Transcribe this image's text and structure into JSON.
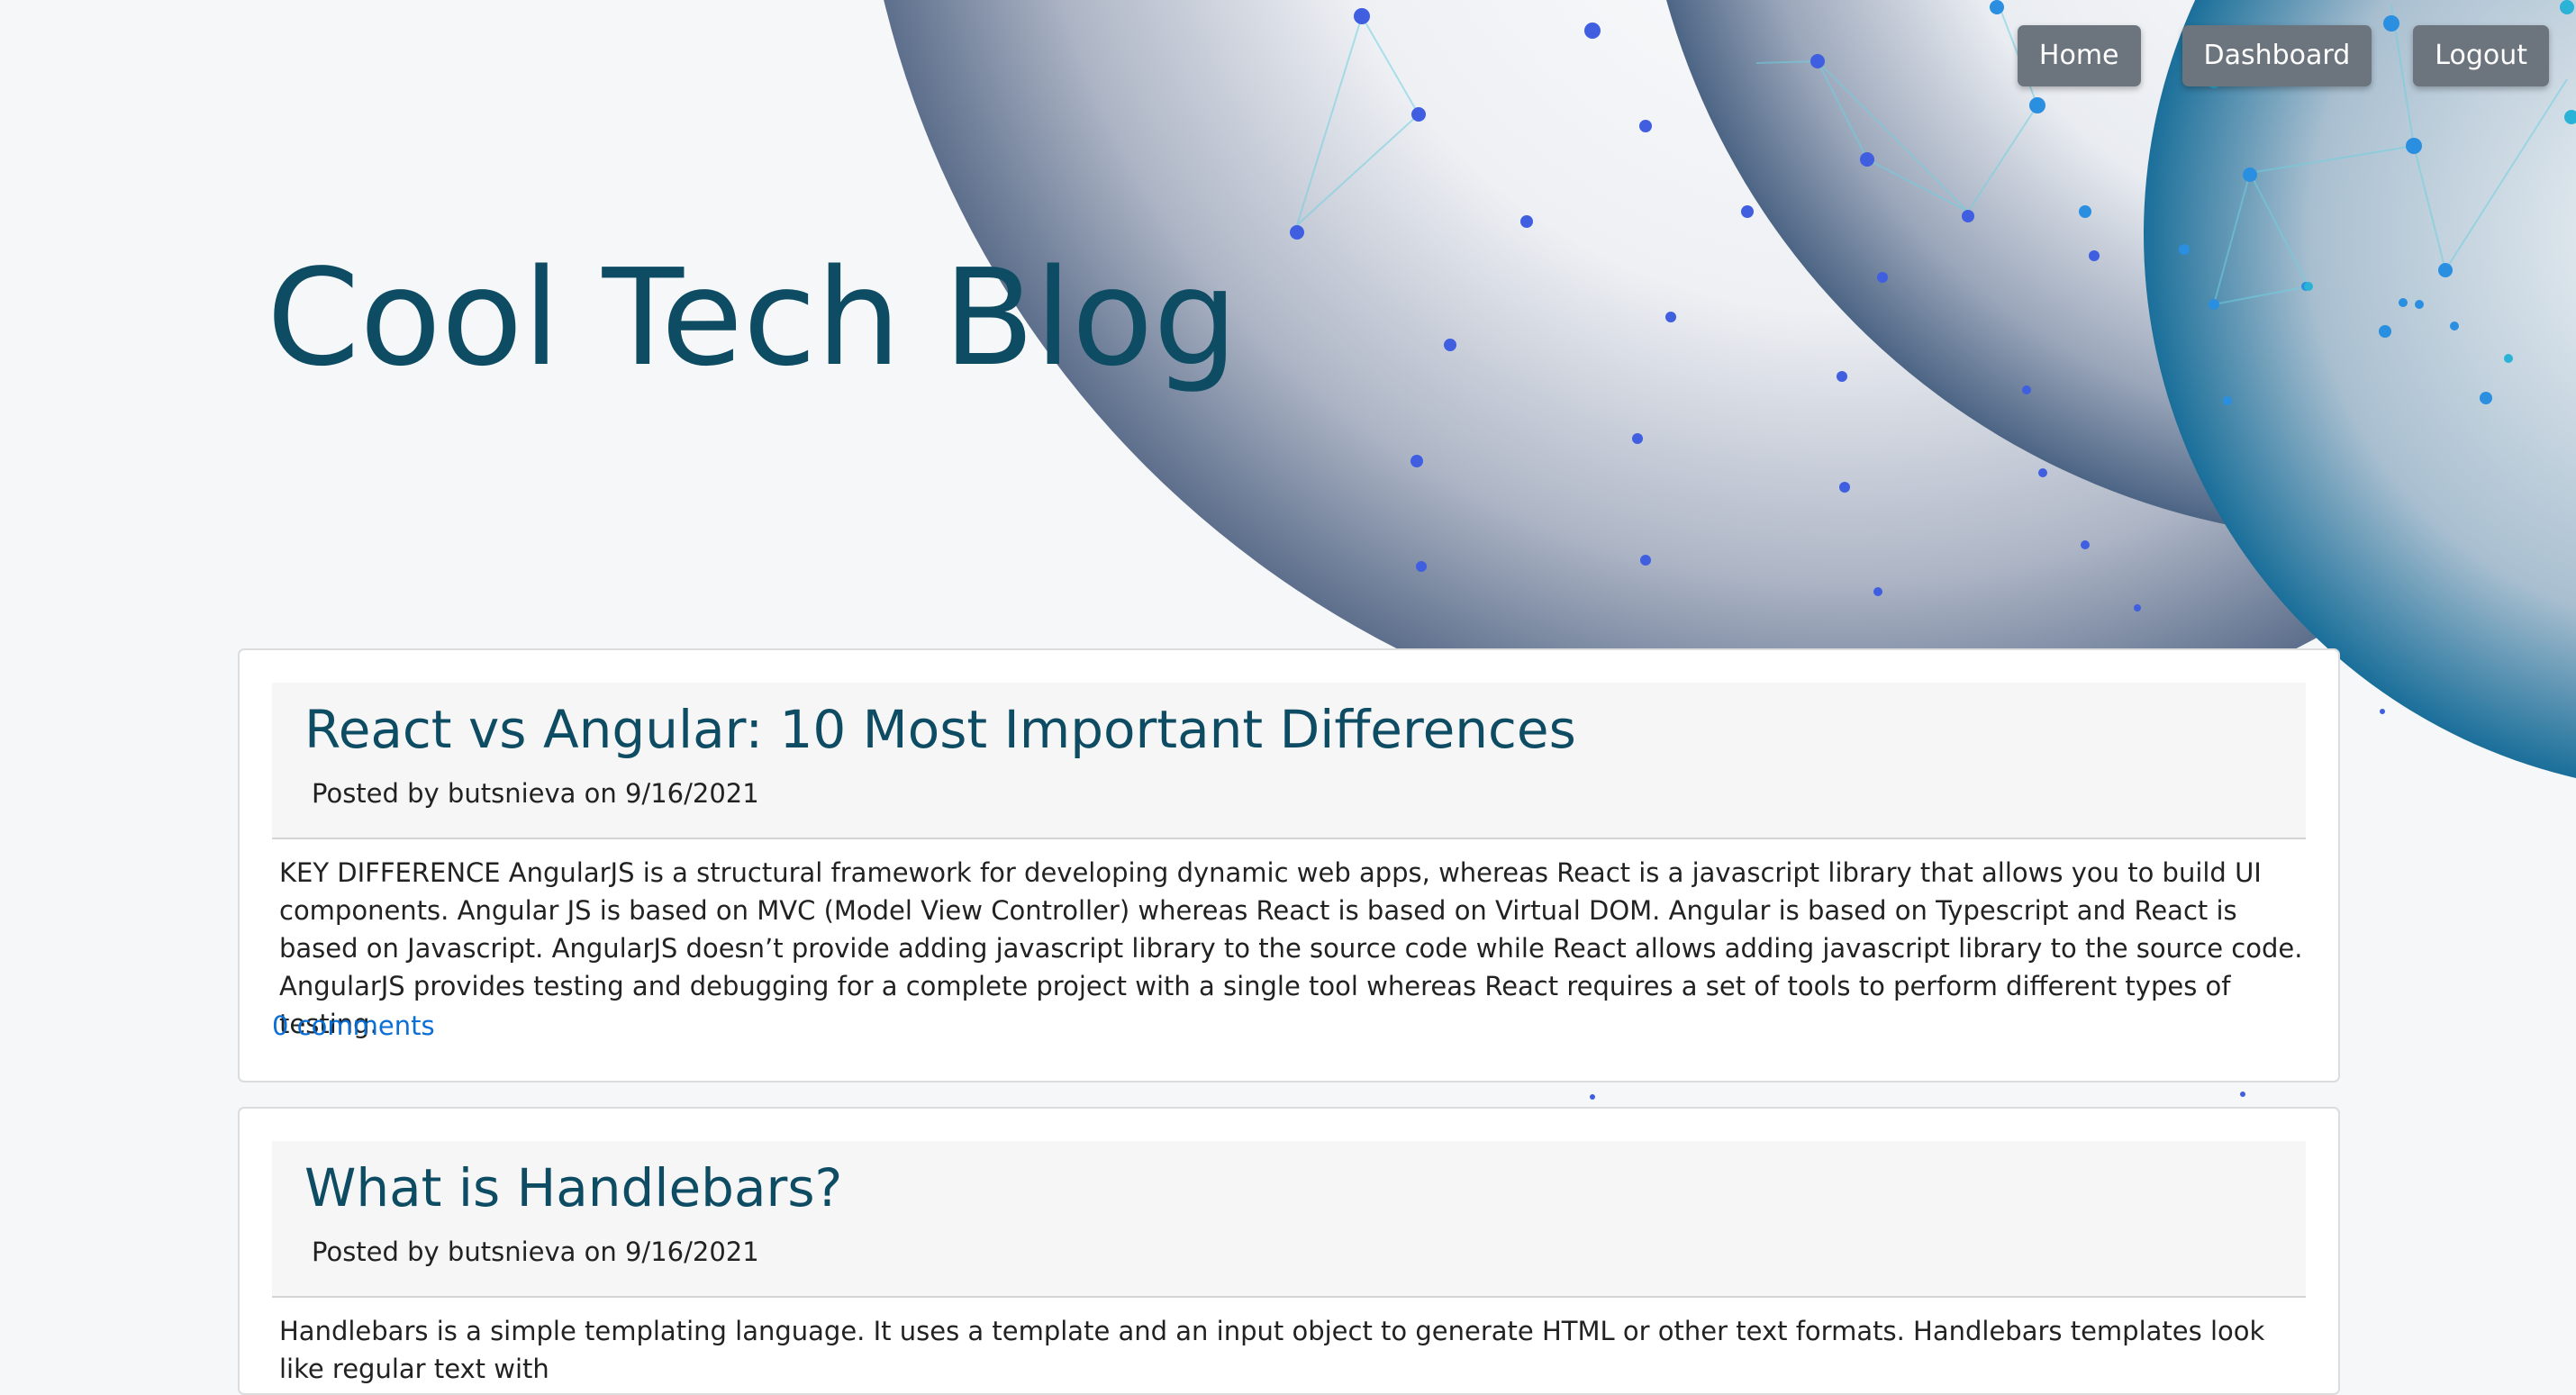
{
  "nav": {
    "home": "Home",
    "dashboard": "Dashboard",
    "logout": "Logout"
  },
  "header": {
    "title": "Cool Tech Blog"
  },
  "posts": [
    {
      "title": "React vs Angular: 10 Most Important Differences",
      "meta": "Posted by butsnieva on 9/16/2021",
      "body": "KEY DIFFERENCE AngularJS is a structural framework for developing dynamic web apps, whereas React is a javascript library that allows you to build UI components. Angular JS is based on MVC (Model View Controller) whereas React is based on Virtual DOM. Angular is based on Typescript and React is based on Javascript. AngularJS doesn’t provide adding javascript library to the source code while React allows adding javascript library to the source code. AngularJS provides testing and debugging for a complete project with a single tool whereas React requires a set of tools to perform different types of testing.",
      "comments": "0 comments"
    },
    {
      "title": "What is Handlebars?",
      "meta": "Posted by butsnieva on 9/16/2021",
      "body": "Handlebars is a simple templating language. It uses a template and an input object to generate HTML or other text formats. Handlebars templates look like regular text with"
    }
  ],
  "colors": {
    "title": "#0d4c63",
    "nav_button": "#6c757d",
    "link": "#0a6fd6",
    "node_blue": "#3f5fe0",
    "node_cyan": "#2ab3d6"
  }
}
